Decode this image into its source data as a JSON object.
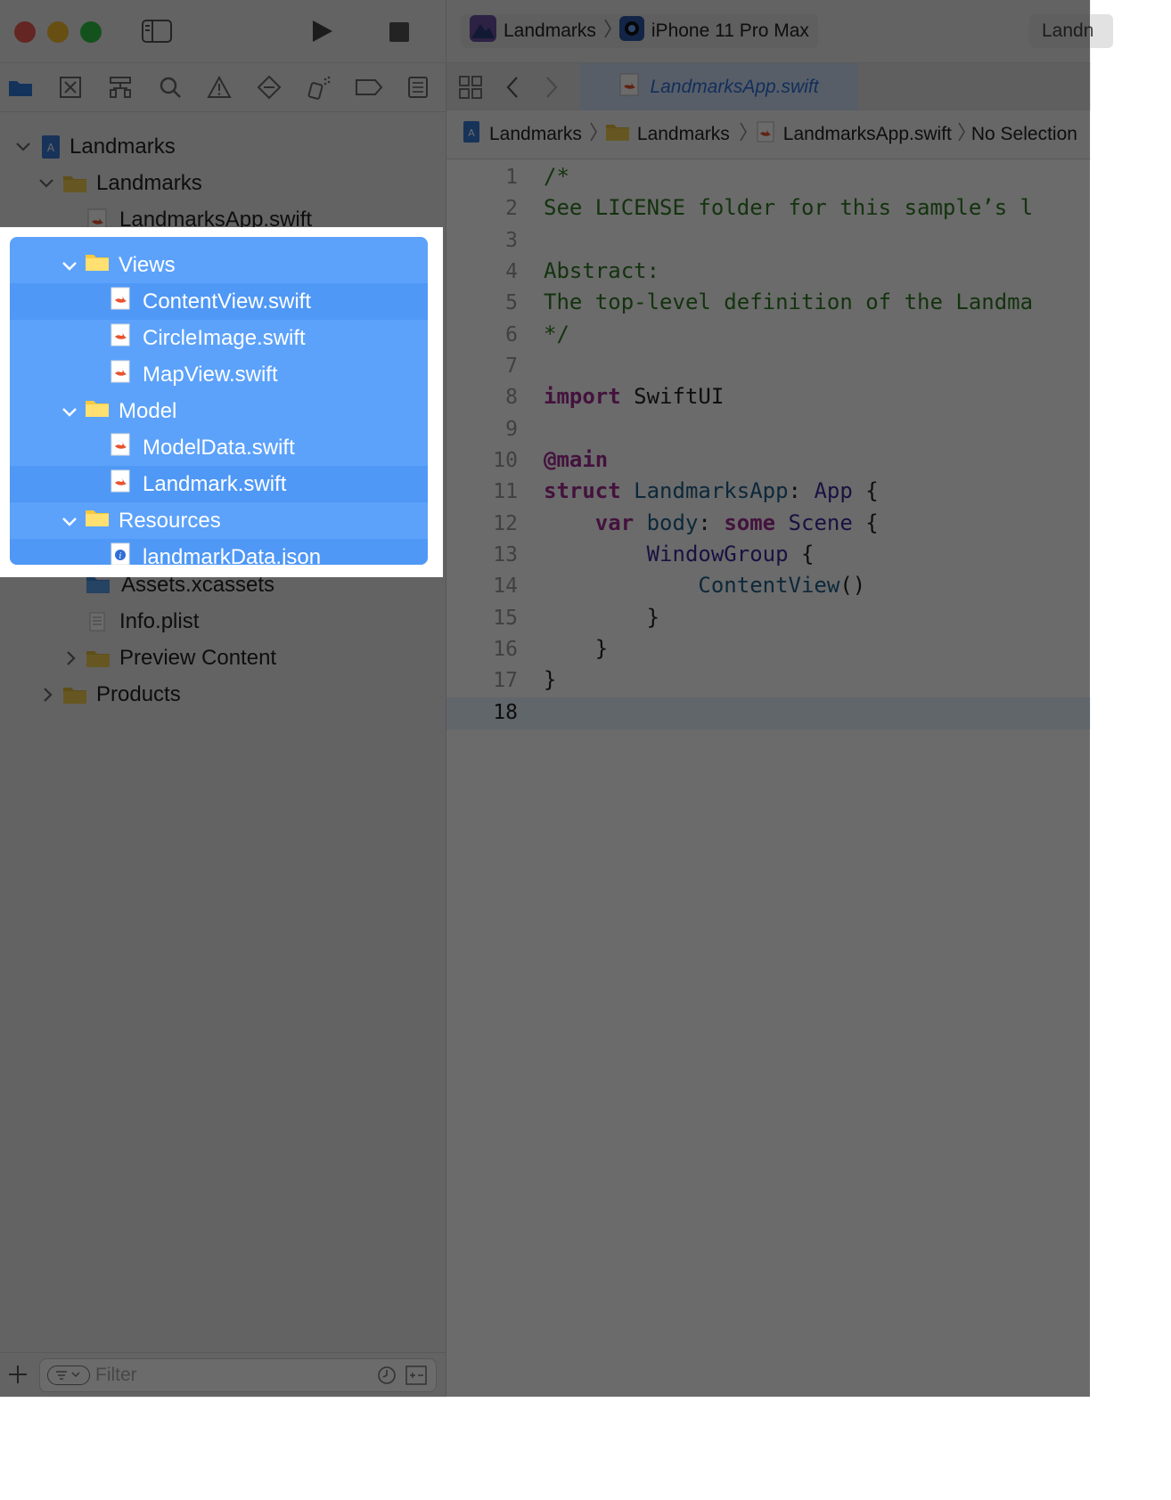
{
  "window": {
    "scheme": {
      "project": "Landmarks",
      "device": "iPhone 11 Pro Max"
    },
    "status_partial": "Landn"
  },
  "navigator": {
    "tree": [
      {
        "label": "Landmarks",
        "kind": "project",
        "expanded": true
      },
      {
        "label": "Landmarks",
        "kind": "folder",
        "expanded": true
      },
      {
        "label": "LandmarksApp.swift",
        "kind": "swift"
      },
      {
        "label": "Views",
        "kind": "folder",
        "expanded": true
      },
      {
        "label": "ContentView.swift",
        "kind": "swift"
      },
      {
        "label": "CircleImage.swift",
        "kind": "swift"
      },
      {
        "label": "MapView.swift",
        "kind": "swift"
      },
      {
        "label": "Model",
        "kind": "folder",
        "expanded": true
      },
      {
        "label": "ModelData.swift",
        "kind": "swift"
      },
      {
        "label": "Landmark.swift",
        "kind": "swift"
      },
      {
        "label": "Resources",
        "kind": "folder",
        "expanded": true
      },
      {
        "label": "landmarkData.json",
        "kind": "json"
      },
      {
        "label": "Assets.xcassets",
        "kind": "assets"
      },
      {
        "label": "Info.plist",
        "kind": "plist"
      },
      {
        "label": "Preview Content",
        "kind": "folder",
        "expanded": false
      },
      {
        "label": "Products",
        "kind": "folder",
        "expanded": false
      }
    ],
    "filter_placeholder": "Filter"
  },
  "editor": {
    "active_tab": "LandmarksApp.swift",
    "jumpbar": [
      "Landmarks",
      "Landmarks",
      "LandmarksApp.swift",
      "No Selection"
    ],
    "lines": [
      "/*",
      "See LICENSE folder for this sample’s l",
      "",
      "Abstract:",
      "The top-level definition of the Landma",
      "*/",
      "",
      "import SwiftUI",
      "",
      "@main",
      "struct LandmarksApp: App {",
      "    var body: some Scene {",
      "        WindowGroup {",
      "            ContentView()",
      "        }",
      "    }",
      "}",
      ""
    ],
    "line_numbers": [
      "1",
      "2",
      "3",
      "4",
      "5",
      "6",
      "7",
      "8",
      "9",
      "10",
      "11",
      "12",
      "13",
      "14",
      "15",
      "16",
      "17",
      "18"
    ],
    "current_line": "18"
  },
  "colors": {
    "selection": "#5ca2fb",
    "comment": "#2f7a22",
    "keyword": "#a02b91",
    "type": "#3b2b9c"
  }
}
